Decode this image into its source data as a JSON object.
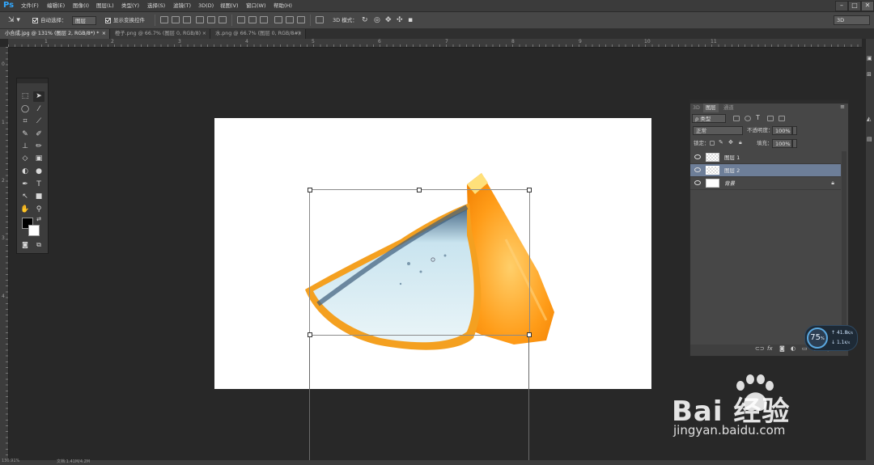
{
  "app": {
    "logo": "Ps"
  },
  "menu": [
    "文件(F)",
    "编辑(E)",
    "图像(I)",
    "图层(L)",
    "类型(Y)",
    "选择(S)",
    "滤镜(T)",
    "3D(D)",
    "视图(V)",
    "窗口(W)",
    "帮助(H)"
  ],
  "window": {
    "restore": "□",
    "close": "✕",
    "minimize": "–"
  },
  "options": {
    "auto_select_label": "自动选择：",
    "auto_select_value": "图层",
    "show_transform_label": "显示变换控件",
    "mode_3d_label": "3D 模式：",
    "workspace": "3D"
  },
  "tabs": [
    {
      "label": "小合成.jpg @ 131% (图层 2, RGB/8*) *",
      "close": "×"
    },
    {
      "label": "橙子.png @ 66.7% (图层 0, RGB/8)",
      "close": "×"
    },
    {
      "label": "水.png @ 66.7% (图层 0, RGB/8#)",
      "close": "×"
    }
  ],
  "ruler_top": [
    "1",
    "2",
    "3",
    "4",
    "5",
    "6",
    "7",
    "8",
    "9",
    "10",
    "11"
  ],
  "ruler_left": [
    "0",
    "1",
    "2",
    "3",
    "4"
  ],
  "layers_panel": {
    "tabs": [
      "3D",
      "图层",
      "通道"
    ],
    "kind_filter": "ρ 类型",
    "blend_mode": "正常",
    "opacity_label": "不透明度：",
    "opacity_value": "100%",
    "lock_label": "锁定：",
    "fill_label": "填充：",
    "fill_value": "100%",
    "layers": [
      {
        "name": "图层 1",
        "selected": false
      },
      {
        "name": "图层 2",
        "selected": true
      },
      {
        "name": "背景",
        "selected": false
      }
    ],
    "footer_icons": [
      "link-icon",
      "fx-icon",
      "mask-icon",
      "adjustment-icon",
      "folder-icon",
      "new-layer-icon",
      "trash-icon"
    ]
  },
  "net_widget": {
    "percent": "75",
    "unit": "%",
    "up": "41.8",
    "up_unit": "K/s",
    "down": "1.1",
    "down_unit": "K/s"
  },
  "status": {
    "zoom": "130.91%",
    "doc": "文档:1.41M/4.2M"
  },
  "watermark": {
    "brand": "Bai 经验",
    "url": "jingyan.baidu.com"
  }
}
